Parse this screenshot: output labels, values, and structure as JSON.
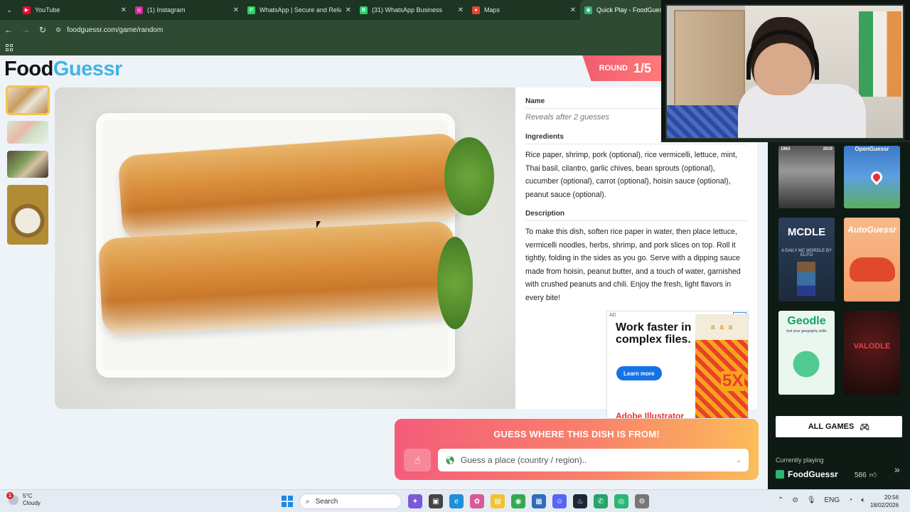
{
  "browser": {
    "tabs": [
      {
        "title": "YouTube",
        "icon": "youtube-icon",
        "color": "#ff0033",
        "glyph": "▶"
      },
      {
        "title": "(1) Instagram",
        "icon": "instagram-icon",
        "color": "#d6249f",
        "glyph": "◎"
      },
      {
        "title": "WhatsApp | Secure and Reliable",
        "icon": "whatsapp-icon",
        "color": "#25d366",
        "glyph": "✆"
      },
      {
        "title": "(31) WhatsApp Business",
        "icon": "whatsapp-business-icon",
        "color": "#25d366",
        "glyph": "B"
      },
      {
        "title": "Maps",
        "icon": "maps-icon",
        "color": "#ea4335",
        "glyph": "●"
      },
      {
        "title": "Quick Play - FoodGuessr",
        "icon": "foodguessr-icon",
        "color": "#2bb673",
        "glyph": "◉"
      }
    ],
    "url": "foodguessr.com/game/random"
  },
  "game": {
    "logo_part1": "Food",
    "logo_part2": "Guessr",
    "round_label": "ROUND",
    "round_value": "1/5",
    "name_label": "Name",
    "name_placeholder": "Reveals after 2 guesses",
    "ingredients_label": "Ingredients",
    "ingredients_text": "Rice paper, shrimp, pork (optional), rice vermicelli, lettuce, mint, Thai basil, cilantro, garlic chives, bean sprouts (optional), cucumber (optional), carrot (optional), hoisin sauce (optional), peanut sauce (optional).",
    "description_label": "Description",
    "description_text": "To make this dish, soften rice paper in water, then place lettuce, vermicelli noodles, herbs, shrimp, and pork slices on top. Roll it tightly, folding in the sides as you go. Serve with a dipping sauce made from hoisin, peanut butter, and a touch of water, garnished with crushed peanuts and chili. Enjoy the fresh, light flavors in every bite!",
    "guess_title": "GUESS WHERE THIS DISH IS FROM!",
    "guess_placeholder": "Guess a place (country / region).."
  },
  "ad": {
    "tag": "AD",
    "headline": "Work faster in complex files.",
    "cta": "Learn more",
    "brand": "Adobe Illustrator",
    "art_glyphs": "a a a",
    "art_big": "5X"
  },
  "sidebar": {
    "tiles": {
      "lincoln_year_left": "1963",
      "lincoln_year_right": "2019",
      "open_title": "OpenGuessr",
      "mcdle_title": "MCDLE",
      "mcdle_sub": "A DAILY MC WORDLE BY ELITO",
      "auto_title": "AutoGuessr",
      "geodle_title": "Geodle",
      "geodle_sub": "test your geography skills",
      "valodle_title": "VALODLE"
    },
    "all_games": "ALL GAMES",
    "currently_playing_label": "Currently playing",
    "currently_playing_name": "FoodGuessr",
    "likes": "586"
  },
  "taskbar": {
    "weather_badge": "1",
    "temperature": "5°C",
    "condition": "Cloudy",
    "search": "Search",
    "language": "ENG",
    "time": "20:56",
    "date": "18/02/2026"
  }
}
